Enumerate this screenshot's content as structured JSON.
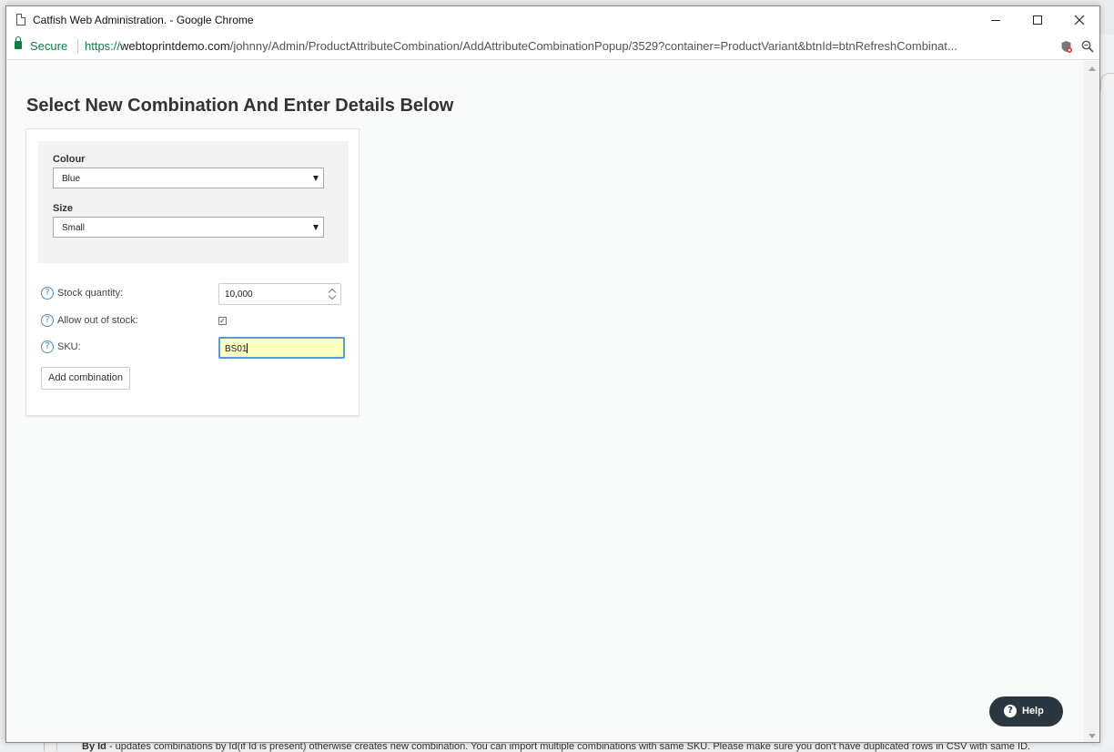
{
  "window": {
    "title": "Catfish Web Administration. - Google Chrome"
  },
  "addressbar": {
    "secure_label": "Secure",
    "url_scheme": "https://",
    "url_host": "webtoprintdemo.com",
    "url_path": "/johnny/Admin/ProductAttributeCombination/AddAttributeCombinationPopup/3529?container=ProductVariant&btnId=btnRefreshCombinat..."
  },
  "page": {
    "heading": "Select New Combination And Enter Details Below"
  },
  "attributes": {
    "colour_label": "Colour",
    "colour_value": "Blue",
    "size_label": "Size",
    "size_value": "Small"
  },
  "fields": {
    "stock_label": "Stock quantity:",
    "stock_value": "10,000",
    "out_of_stock_label": "Allow out of stock:",
    "out_of_stock_checked": true,
    "sku_label": "SKU:",
    "sku_value": "BS01"
  },
  "actions": {
    "add_label": "Add combination",
    "help_label": "Help"
  },
  "background": {
    "strip_bold": "By Id",
    "strip_text": " - updates combinations by Id(if Id is present) otherwise creates new combination. You can import multiple combinations with same SKU. Please make sure you don't have duplicated rows in CSV with same ID."
  },
  "icons": {
    "help": "question-circle-icon",
    "lock": "lock-icon",
    "page": "page-icon"
  },
  "colors": {
    "accent": "#5b9bd5",
    "secure_green": "#0b8043",
    "help_bg": "#2a3740",
    "sku_highlight": "#ffffc0"
  }
}
